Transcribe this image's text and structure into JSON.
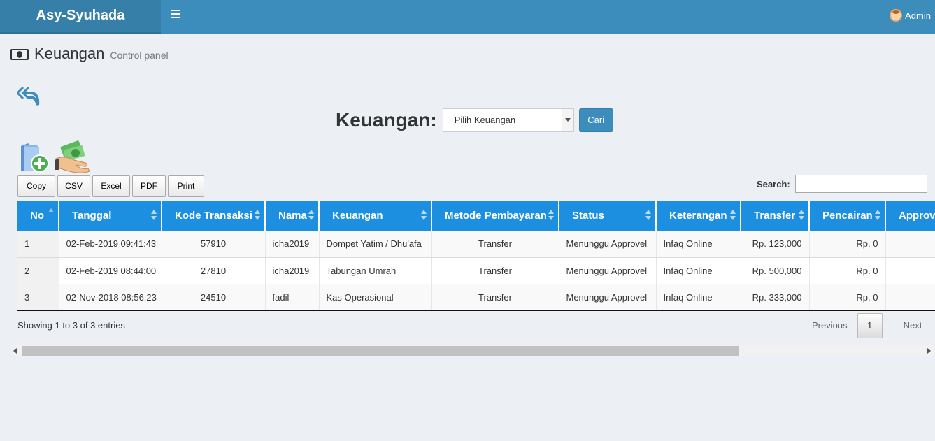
{
  "app": {
    "brand": "Asy-Syuhada",
    "user": "Admin"
  },
  "page": {
    "title": "Keuangan",
    "subtitle": "Control panel"
  },
  "filter": {
    "label": "Keuangan:",
    "select_value": "Pilih Keuangan",
    "button": "Cari"
  },
  "export": {
    "copy": "Copy",
    "csv": "CSV",
    "excel": "Excel",
    "pdf": "PDF",
    "print": "Print"
  },
  "search": {
    "label": "Search:",
    "value": ""
  },
  "table": {
    "columns": [
      "No",
      "Tanggal",
      "Kode Transaksi",
      "Nama",
      "Keuangan",
      "Metode Pembayaran",
      "Status",
      "Keterangan",
      "Transfer",
      "Pencairan",
      "Approv"
    ],
    "rows": [
      [
        "1",
        "02-Feb-2019 09:41:43",
        "57910",
        "icha2019",
        "Dompet Yatim / Dhu'afa",
        "Transfer",
        "Menunggu Approvel",
        "Infaq Online",
        "Rp. 123,000",
        "Rp. 0",
        ""
      ],
      [
        "2",
        "02-Feb-2019 08:44:00",
        "27810",
        "icha2019",
        "Tabungan Umrah",
        "Transfer",
        "Menunggu Approvel",
        "Infaq Online",
        "Rp. 500,000",
        "Rp. 0",
        ""
      ],
      [
        "3",
        "02-Nov-2018 08:56:23",
        "24510",
        "fadil",
        "Kas Operasional",
        "Transfer",
        "Menunggu Approvel",
        "Infaq Online",
        "Rp. 333,000",
        "Rp. 0",
        ""
      ]
    ]
  },
  "footer": {
    "info": "Showing 1 to 3 of 3 entries",
    "previous": "Previous",
    "page": "1",
    "next": "Next"
  },
  "icons": {
    "menu": "hamburger-icon",
    "user": "avatar",
    "page": "money-bill-icon",
    "back": "reply-all-icon",
    "add": "folder-add-icon",
    "money": "money-hand-icon"
  },
  "colors": {
    "header": "#3c8dbc",
    "logo_bg": "#367fa9",
    "table_header": "#1d8fe1",
    "button_primary": "#3c8dbc"
  }
}
